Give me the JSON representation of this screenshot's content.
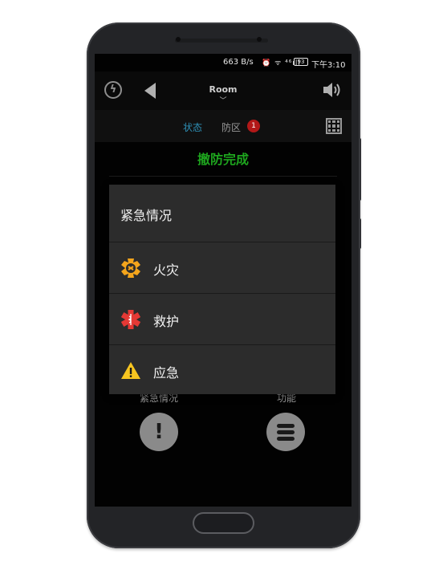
{
  "status_bar": {
    "net_speed": "663 B/s",
    "signal_icons": "⏰ ᯤ ⁴⁶ıll",
    "battery": "93",
    "time": "下午3:10"
  },
  "top_bar": {
    "room_title": "Room",
    "room_chevron": "﹀",
    "icons": [
      "logo-icon",
      "back-arrow-icon",
      "volume-icon"
    ]
  },
  "tabs": {
    "status": "状态",
    "zone": "防区",
    "zone_badge": "1",
    "active_color": "#2e8fb5"
  },
  "arm_status": {
    "text": "撤防完成",
    "color": "#1ea51e"
  },
  "bottom_actions": {
    "emergency_label": "紧急情况",
    "function_label": "功能",
    "emergency_glyph": "!"
  },
  "emergency_dialog": {
    "title": "紧急情况",
    "items": [
      {
        "label": "火灾",
        "icon": "fire-icon",
        "color": "#f4a51c"
      },
      {
        "label": "救护",
        "icon": "ambulance-icon",
        "color": "#e53935"
      },
      {
        "label": "应急",
        "icon": "warning-icon",
        "color": "#f7c520"
      }
    ]
  }
}
